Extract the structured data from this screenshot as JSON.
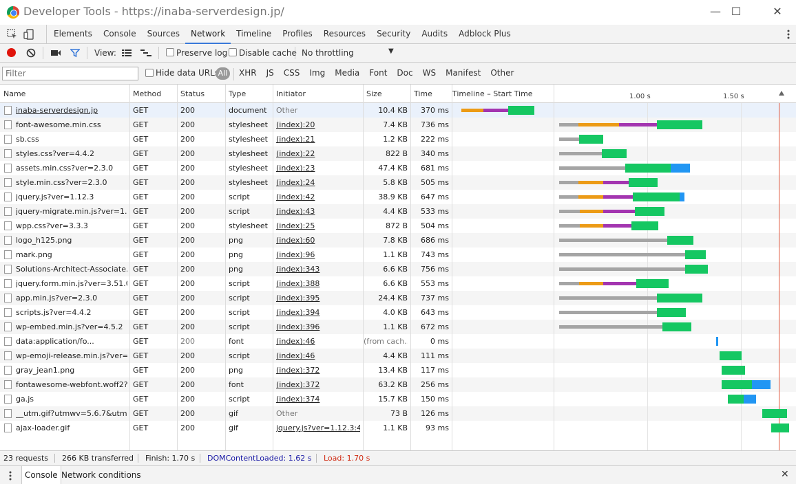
{
  "window": {
    "title": "Developer Tools - https://inaba-serverdesign.jp/"
  },
  "devtools_tabs": [
    "Elements",
    "Console",
    "Sources",
    "Network",
    "Timeline",
    "Profiles",
    "Resources",
    "Security",
    "Audits",
    "Adblock Plus"
  ],
  "active_tab": "Network",
  "toolbar": {
    "view_label": "View:",
    "preserve_log": "Preserve log",
    "disable_cache": "Disable cache",
    "throttling": "No throttling"
  },
  "filterbar": {
    "placeholder": "Filter",
    "hide_data_urls": "Hide data URLs",
    "all": "All",
    "types": [
      "XHR",
      "JS",
      "CSS",
      "Img",
      "Media",
      "Font",
      "Doc",
      "WS",
      "Manifest",
      "Other"
    ]
  },
  "columns": {
    "name": "Name",
    "method": "Method",
    "status": "Status",
    "type": "Type",
    "initiator": "Initiator",
    "size": "Size",
    "time": "Time",
    "timeline": "Timeline – Start Time"
  },
  "timeline_ticks": [
    "1.00 s",
    "1.50 s"
  ],
  "colors": {
    "waiting": "#a5a5a5",
    "dns": "#ec9b16",
    "connect": "#a335b0",
    "ttfb": "#15c762",
    "download": "#2196f3",
    "load": "#e0543a",
    "domcontent": "#1a1aa6"
  },
  "requests": [
    {
      "name": "inaba-serverdesign.jp",
      "method": "GET",
      "status": "200",
      "type": "document",
      "initiator": "Other",
      "size": "10.4 KB",
      "time": "370 ms"
    },
    {
      "name": "font-awesome.min.css",
      "method": "GET",
      "status": "200",
      "type": "stylesheet",
      "initiator": "(index):20",
      "size": "7.4 KB",
      "time": "736 ms"
    },
    {
      "name": "sb.css",
      "method": "GET",
      "status": "200",
      "type": "stylesheet",
      "initiator": "(index):21",
      "size": "1.2 KB",
      "time": "222 ms"
    },
    {
      "name": "styles.css?ver=4.4.2",
      "method": "GET",
      "status": "200",
      "type": "stylesheet",
      "initiator": "(index):22",
      "size": "822 B",
      "time": "340 ms"
    },
    {
      "name": "assets.min.css?ver=2.3.0",
      "method": "GET",
      "status": "200",
      "type": "stylesheet",
      "initiator": "(index):23",
      "size": "47.4 KB",
      "time": "681 ms"
    },
    {
      "name": "style.min.css?ver=2.3.0",
      "method": "GET",
      "status": "200",
      "type": "stylesheet",
      "initiator": "(index):24",
      "size": "5.8 KB",
      "time": "505 ms"
    },
    {
      "name": "jquery.js?ver=1.12.3",
      "method": "GET",
      "status": "200",
      "type": "script",
      "initiator": "(index):42",
      "size": "38.9 KB",
      "time": "647 ms"
    },
    {
      "name": "jquery-migrate.min.js?ver=1.4.0",
      "method": "GET",
      "status": "200",
      "type": "script",
      "initiator": "(index):43",
      "size": "4.4 KB",
      "time": "533 ms"
    },
    {
      "name": "wpp.css?ver=3.3.3",
      "method": "GET",
      "status": "200",
      "type": "stylesheet",
      "initiator": "(index):25",
      "size": "872 B",
      "time": "504 ms"
    },
    {
      "name": "logo_h125.png",
      "method": "GET",
      "status": "200",
      "type": "png",
      "initiator": "(index):60",
      "size": "7.8 KB",
      "time": "686 ms"
    },
    {
      "name": "mark.png",
      "method": "GET",
      "status": "200",
      "type": "png",
      "initiator": "(index):96",
      "size": "1.1 KB",
      "time": "743 ms"
    },
    {
      "name": "Solutions-Architect-Associate.p...",
      "method": "GET",
      "status": "200",
      "type": "png",
      "initiator": "(index):343",
      "size": "6.6 KB",
      "time": "756 ms"
    },
    {
      "name": "jquery.form.min.js?ver=3.51.0-2...",
      "method": "GET",
      "status": "200",
      "type": "script",
      "initiator": "(index):388",
      "size": "6.6 KB",
      "time": "553 ms"
    },
    {
      "name": "app.min.js?ver=2.3.0",
      "method": "GET",
      "status": "200",
      "type": "script",
      "initiator": "(index):395",
      "size": "24.4 KB",
      "time": "737 ms"
    },
    {
      "name": "scripts.js?ver=4.4.2",
      "method": "GET",
      "status": "200",
      "type": "script",
      "initiator": "(index):394",
      "size": "4.0 KB",
      "time": "643 ms"
    },
    {
      "name": "wp-embed.min.js?ver=4.5.2",
      "method": "GET",
      "status": "200",
      "type": "script",
      "initiator": "(index):396",
      "size": "1.1 KB",
      "time": "672 ms"
    },
    {
      "name": "data:application/fo...",
      "method": "GET",
      "status": "200",
      "type": "font",
      "initiator": "(index):46",
      "size": "(from cach...",
      "time": "0 ms"
    },
    {
      "name": "wp-emoji-release.min.js?ver=4....",
      "method": "GET",
      "status": "200",
      "type": "script",
      "initiator": "(index):46",
      "size": "4.4 KB",
      "time": "111 ms"
    },
    {
      "name": "gray_jean1.png",
      "method": "GET",
      "status": "200",
      "type": "png",
      "initiator": "(index):372",
      "size": "13.4 KB",
      "time": "117 ms"
    },
    {
      "name": "fontawesome-webfont.woff2?v...",
      "method": "GET",
      "status": "200",
      "type": "font",
      "initiator": "(index):372",
      "size": "63.2 KB",
      "time": "256 ms"
    },
    {
      "name": "ga.js",
      "method": "GET",
      "status": "200",
      "type": "script",
      "initiator": "(index):374",
      "size": "15.7 KB",
      "time": "150 ms"
    },
    {
      "name": "__utm.gif?utmwv=5.6.7&utms=...",
      "method": "GET",
      "status": "200",
      "type": "gif",
      "initiator": "Other",
      "size": "73 B",
      "time": "126 ms"
    },
    {
      "name": "ajax-loader.gif",
      "method": "GET",
      "status": "200",
      "type": "gif",
      "initiator": "jquery.js?ver=1.12.3:4",
      "size": "1.1 KB",
      "time": "93 ms"
    }
  ],
  "status": {
    "requests": "23 requests",
    "transferred": "266 KB transferred",
    "finish": "Finish: 1.70 s",
    "domcontentloaded": "DOMContentLoaded: 1.62 s",
    "load": "Load: 1.70 s"
  },
  "drawer": {
    "tabs": [
      "Console",
      "Network conditions"
    ]
  }
}
